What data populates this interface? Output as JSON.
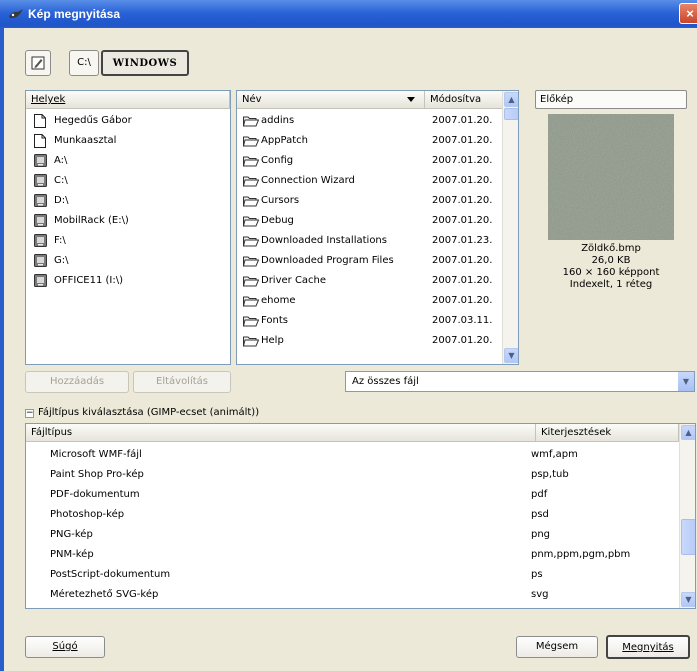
{
  "window": {
    "title": "Kép megnyitása",
    "close": "×"
  },
  "path": {
    "segments": [
      "C:\\",
      "WINDOWS"
    ]
  },
  "places": {
    "header": "Helyek",
    "items": [
      {
        "label": "Hegedűs Gábor",
        "icon": "document-icon"
      },
      {
        "label": "Munkaasztal",
        "icon": "document-icon"
      },
      {
        "label": "A:\\",
        "icon": "drive-icon"
      },
      {
        "label": "C:\\",
        "icon": "drive-icon"
      },
      {
        "label": "D:\\",
        "icon": "drive-icon"
      },
      {
        "label": "MobilRack (E:\\)",
        "icon": "drive-icon"
      },
      {
        "label": "F:\\",
        "icon": "drive-icon"
      },
      {
        "label": "G:\\",
        "icon": "drive-icon"
      },
      {
        "label": "OFFICE11 (I:\\)",
        "icon": "drive-icon"
      }
    ],
    "add": "Hozzáadás",
    "remove": "Eltávolítás"
  },
  "files": {
    "col_name": "Név",
    "col_modified": "Módosítva",
    "rows": [
      {
        "name": "addins",
        "date": "2007.01.20."
      },
      {
        "name": "AppPatch",
        "date": "2007.01.20."
      },
      {
        "name": "Config",
        "date": "2007.01.20."
      },
      {
        "name": "Connection Wizard",
        "date": "2007.01.20."
      },
      {
        "name": "Cursors",
        "date": "2007.01.20."
      },
      {
        "name": "Debug",
        "date": "2007.01.20."
      },
      {
        "name": "Downloaded Installations",
        "date": "2007.01.23."
      },
      {
        "name": "Downloaded Program Files",
        "date": "2007.01.20."
      },
      {
        "name": "Driver Cache",
        "date": "2007.01.20."
      },
      {
        "name": "ehome",
        "date": "2007.01.20."
      },
      {
        "name": "Fonts",
        "date": "2007.03.11."
      },
      {
        "name": "Help",
        "date": "2007.01.20."
      }
    ],
    "filter": "Az összes fájl"
  },
  "preview": {
    "button": "Előkép",
    "filename": "Zöldkő.bmp",
    "size": "26,0 KB",
    "dimensions": "160 × 160 képpont",
    "mode": "Indexelt, 1 réteg"
  },
  "filetype": {
    "expander": "Fájltípus kiválasztása (GIMP-ecset (animált))",
    "col_type": "Fájltípus",
    "col_ext": "Kiterjesztések",
    "rows": [
      {
        "type": "Microsoft WMF-fájl",
        "ext": "wmf,apm"
      },
      {
        "type": "Paint Shop Pro-kép",
        "ext": "psp,tub"
      },
      {
        "type": "PDF-dokumentum",
        "ext": "pdf"
      },
      {
        "type": "Photoshop-kép",
        "ext": "psd"
      },
      {
        "type": "PNG-kép",
        "ext": "png"
      },
      {
        "type": "PNM-kép",
        "ext": "pnm,ppm,pgm,pbm"
      },
      {
        "type": "PostScript-dokumentum",
        "ext": "ps"
      },
      {
        "type": "Méretezhető SVG-kép",
        "ext": "svg"
      }
    ]
  },
  "buttons": {
    "help": "Súgó",
    "cancel": "Mégsem",
    "open": "Megnyitás"
  },
  "colors": {
    "title_bar": "#2a63d6",
    "selection_border": "#7f9db9",
    "scroll_blue": "#c9d8fc"
  }
}
